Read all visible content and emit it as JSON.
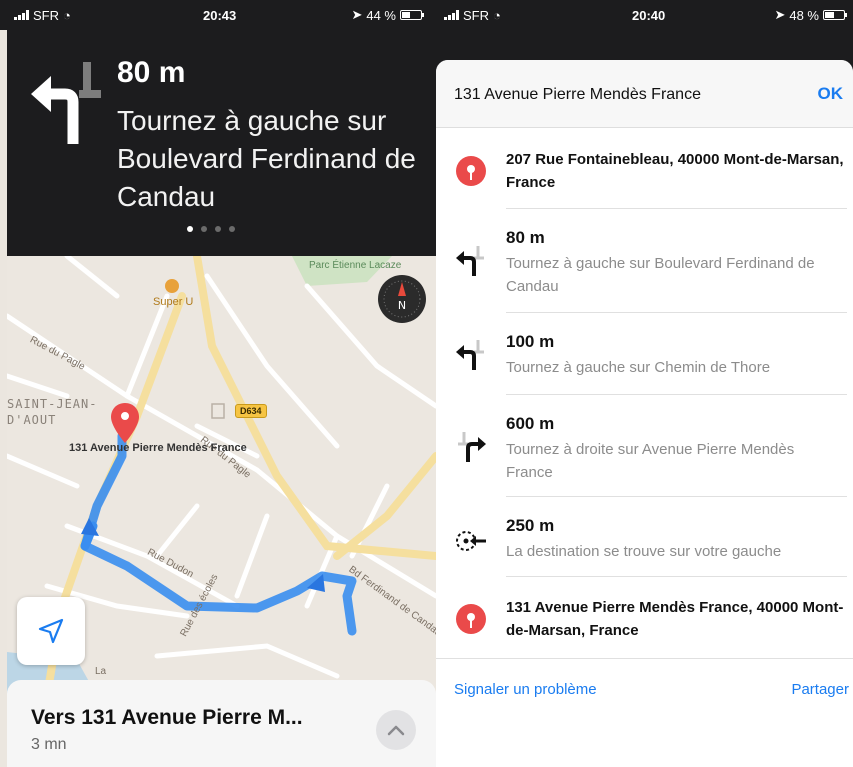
{
  "left": {
    "status": {
      "carrier": "SFR",
      "time": "20:43",
      "battery": "44 %",
      "battery_level": 0.44
    },
    "banner": {
      "distance": "80 m",
      "instruction": "Tournez à gauche sur Boulevard Ferdinand de Candau",
      "page_count": 4,
      "active_page": 0
    },
    "map": {
      "poi_superu": "Super U",
      "park": "Parc Étienne Lacaze",
      "quartier": "SAINT-JEAN-\nD'AOUT",
      "road_badge": "D634",
      "destination_label": "131 Avenue Pierre Mendès France",
      "street_rue_pagle_1": "Rue du Pagle",
      "street_rue_pagle_2": "Rue du Pagle",
      "street_dudon": "Rue Dudon",
      "street_ecoles": "Rue des écoles",
      "street_bd_ferdinand": "Bd Ferdinand de Candau",
      "label_la": "La",
      "route_color": "#3a8ef0",
      "pin_color": "#ea4a4a",
      "compass_letter": "N"
    },
    "bottom_card": {
      "title": "Vers 131 Avenue Pierre M...",
      "eta": "3 mn"
    }
  },
  "right": {
    "status": {
      "carrier": "SFR",
      "time": "20:40",
      "battery": "48 %",
      "battery_level": 0.48
    },
    "sheet": {
      "title": "131 Avenue Pierre Mendès France",
      "ok_label": "OK",
      "origin": "207 Rue Fontainebleau, 40000 Mont-de-Marsan, France",
      "steps": [
        {
          "icon": "turn-left-icon",
          "distance": "80 m",
          "description": "Tournez à gauche sur Boulevard Ferdinand de Candau"
        },
        {
          "icon": "turn-left-icon",
          "distance": "100 m",
          "description": "Tournez à gauche sur Chemin de Thore"
        },
        {
          "icon": "turn-right-icon",
          "distance": "600 m",
          "description": "Tournez à droite sur Avenue Pierre Mendès France"
        },
        {
          "icon": "arrival-icon",
          "distance": "250 m",
          "description": "La destination se trouve sur votre gauche"
        }
      ],
      "destination": "131 Avenue Pierre Mendès France, 40000 Mont-de-Marsan, France",
      "report_label": "Signaler un problème",
      "share_label": "Partager"
    }
  },
  "colors": {
    "accent": "#1a7cf0",
    "pin": "#ea4a4a",
    "route": "#3a8ef0",
    "banner_bg": "#1c1c1e"
  }
}
